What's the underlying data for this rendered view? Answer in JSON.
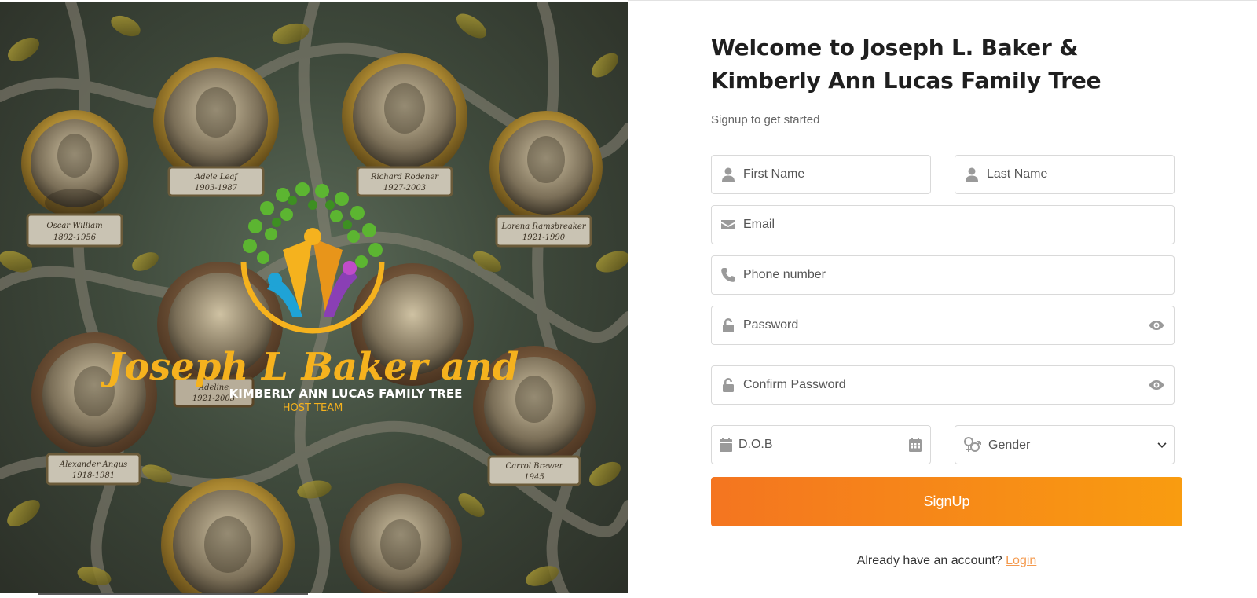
{
  "hero": {
    "logo": {
      "line1": "Joseph L Baker and",
      "line2": "KIMBERLY ANN LUCAS FAMILY TREE",
      "line3": "HOST TEAM"
    },
    "plaques": [
      {
        "name": "Oscar William",
        "years": "1892-1956"
      },
      {
        "name": "Adele Leaf",
        "years": "1903-1987"
      },
      {
        "name": "Richard Rodener",
        "years": "1927-2003"
      },
      {
        "name": "Lorena Ramsbreaker",
        "years": "1921-1990"
      },
      {
        "name": "Adeline",
        "years": "1921-2003"
      },
      {
        "name": "Alexander Angus",
        "years": "1918-1981"
      },
      {
        "name": "Carrol Brewer",
        "years": "1945"
      }
    ]
  },
  "form": {
    "title": "Welcome to Joseph L. Baker & Kimberly Ann Lucas Family Tree",
    "subtitle": "Signup to get started",
    "first_name_placeholder": "First Name",
    "last_name_placeholder": "Last Name",
    "email_placeholder": "Email",
    "phone_placeholder": "Phone number",
    "password_placeholder": "Password",
    "confirm_password_placeholder": "Confirm Password",
    "dob_placeholder": "D.O.B",
    "gender_selected": "Gender",
    "submit_label": "SignUp",
    "login_prompt": "Already have an account?",
    "login_link": "Login"
  },
  "colors": {
    "button_start": "#f47520",
    "button_end": "#f99c10",
    "link": "#f49a4e",
    "logo_yellow": "#f5b21e",
    "logo_green": "#5cb531"
  },
  "icons": [
    "user-icon",
    "envelope-icon",
    "phone-icon",
    "lock-icon",
    "eye-icon",
    "calendar-icon",
    "gender-icon",
    "chevron-down-icon"
  ]
}
